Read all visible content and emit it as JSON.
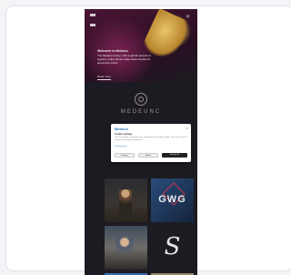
{
  "hero": {
    "title": "Welcome to Medeco",
    "body": "The Medeco Group, with a global network of experts, helps clients make better decisions across the world.",
    "link": "Read more"
  },
  "brand": {
    "logo_text": "MEDEUNC"
  },
  "cookie_modal": {
    "brand": "Medeco",
    "close": "×",
    "title": "Cookie settings",
    "body": "We use cookies to improve your experience and analyse traffic. You can accept all cookies or manage preferences.",
    "link": "Privacy policy",
    "buttons": {
      "settings": "Settings",
      "reject": "Reject",
      "accept": "Accept all"
    }
  },
  "tiles": {
    "gwg": "GWG",
    "s_logo": "S"
  },
  "colors": {
    "page_bg": "#1c1b21",
    "accent_blue": "#2a6fb8",
    "hero_gold": "#c6a24a"
  }
}
